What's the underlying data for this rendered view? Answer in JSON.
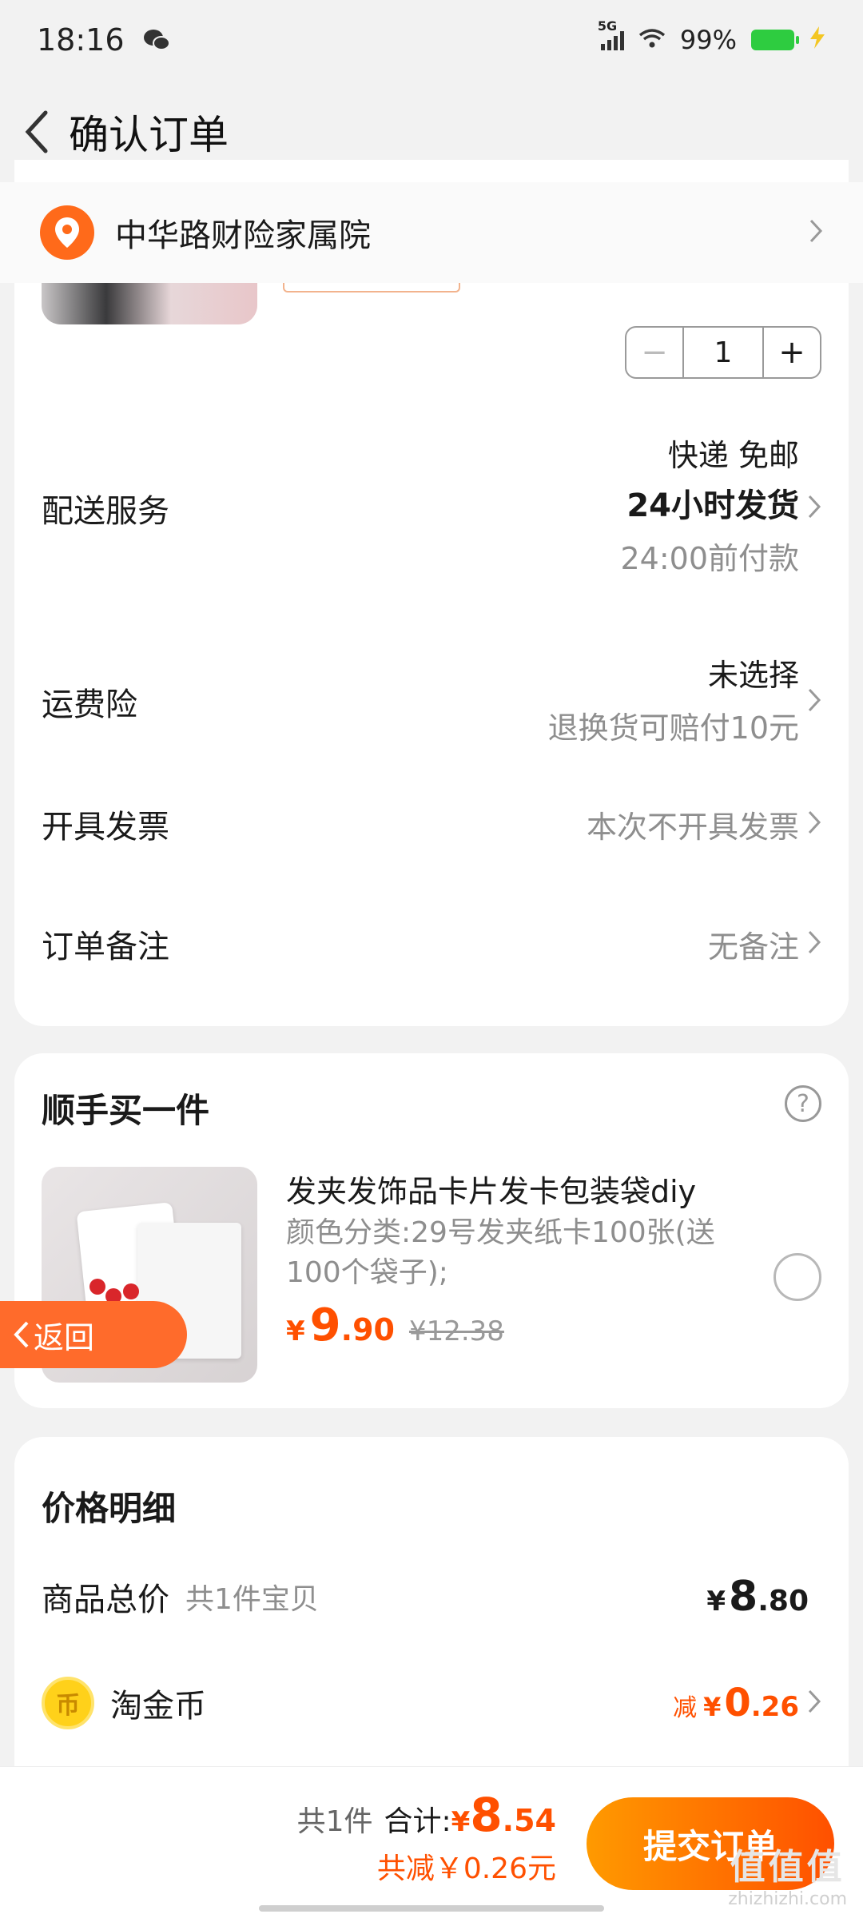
{
  "status_bar": {
    "time": "18:16",
    "network": "5G",
    "battery": "99%"
  },
  "nav": {
    "title": "确认订单"
  },
  "address": {
    "text": "中华路财险家属院"
  },
  "order": {
    "quantity": "1",
    "delivery": {
      "label": "配送服务",
      "method": "快递 免邮",
      "ship_time": "24小时发货",
      "pay_before": "24:00前付款"
    },
    "insurance": {
      "label": "运费险",
      "value": "未选择",
      "hint": "退换货可赔付10元"
    },
    "invoice": {
      "label": "开具发票",
      "value": "本次不开具发票"
    },
    "remark": {
      "label": "订单备注",
      "value": "无备注"
    }
  },
  "addon": {
    "title": "顺手买一件",
    "help_symbol": "?",
    "name": "发夹发饰品卡片发卡包装袋diy",
    "spec": "颜色分类:29号发夹纸卡100张(送100个袋子);",
    "price_yen": "¥",
    "price_int": "9",
    "price_dec": ".90",
    "orig_price": "¥12.38"
  },
  "back_button": {
    "label": "返回"
  },
  "price_detail": {
    "title": "价格明细",
    "total_label": "商品总价",
    "total_count": "共1件宝贝",
    "total_yen": "¥",
    "total_int": "8",
    "total_dec": ".80",
    "coin_label": "淘金币",
    "coin_glyph": "币",
    "coin_pre": "减",
    "coin_yen": "¥",
    "coin_int": "0",
    "coin_dec": ".26"
  },
  "footer": {
    "count": "共1件",
    "total_label": "合计:",
    "total_yen": "¥",
    "total_int": "8",
    "total_dec": ".54",
    "saving": "共减￥0.26元",
    "submit": "提交订单"
  },
  "watermark": {
    "big": "值值值",
    "small": "zhizhizhi.com"
  },
  "colors": {
    "accent": "#ff5000",
    "accent_light": "#ff9a00",
    "background": "#f2f2f2"
  }
}
